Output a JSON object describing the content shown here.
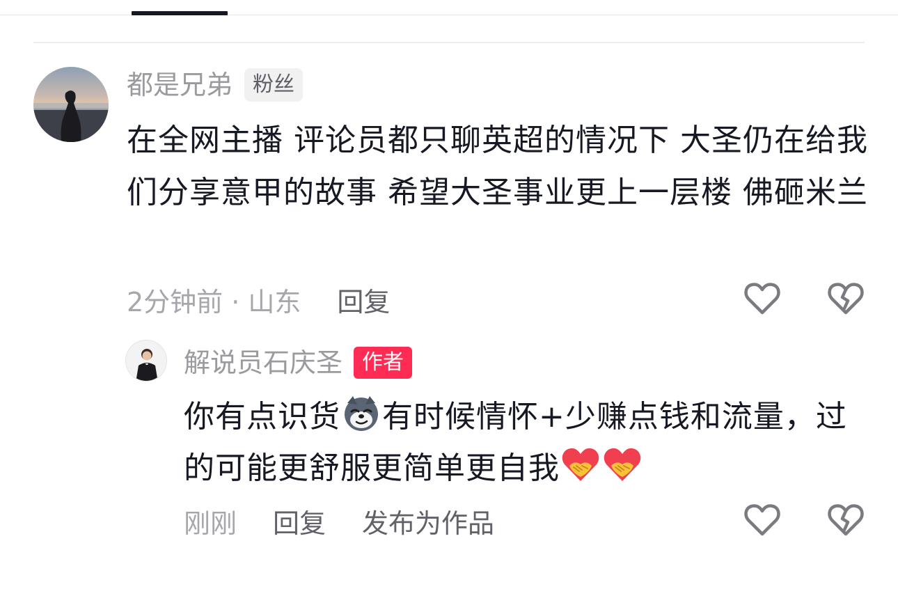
{
  "comment": {
    "username": "都是兄弟",
    "badge": "粉丝",
    "text": "在全网主播 评论员都只聊英超的情况下 大圣仍在给我们分享意甲的故事 希望大圣事业更上一层楼 佛砸米兰",
    "time_location": "2分钟前 · 山东",
    "reply_label": "回复",
    "like_icon": "heart-outline-icon",
    "dislike_icon": "broken-heart-icon"
  },
  "reply": {
    "username": "解说员石庆圣",
    "badge": "作者",
    "text_part1": "你有点识货",
    "emoji1": "smirking-dog-emoji",
    "text_part2": "有时候情怀+少赚点钱和流量，过的可能更舒服更简单更自我",
    "emoji2": "handshake-heart-emoji",
    "time": "刚刚",
    "reply_label": "回复",
    "publish_label": "发布为作品",
    "like_icon": "heart-outline-icon",
    "dislike_icon": "broken-heart-icon"
  },
  "colors": {
    "author_badge": "#fe2c55",
    "fan_badge_bg": "#f1f1f2",
    "muted_text": "#9a9a9f",
    "icon": "#7a7a80"
  }
}
